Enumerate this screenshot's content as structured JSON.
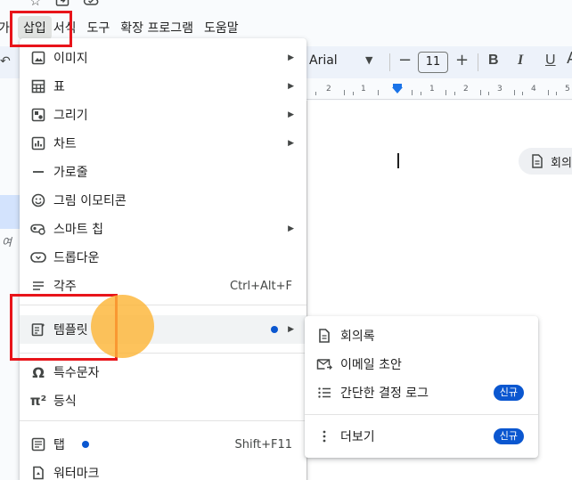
{
  "colors": {
    "accent": "#0b57d0",
    "highlight_box": "#e8141a",
    "pointer": "#fdb638",
    "menu_hover": "#f1f3f4"
  },
  "top_icons": [
    "star-icon",
    "move-to-folder-icon",
    "cloud-status-icon"
  ],
  "menubar": {
    "items": [
      {
        "label": "삽입",
        "active": true
      },
      {
        "label": "서식"
      },
      {
        "label": "도구"
      },
      {
        "label": "확장 프로그램"
      },
      {
        "label": "도움말"
      }
    ]
  },
  "toolbar": {
    "font_name": "Arial",
    "font_size": "11",
    "minus": "−",
    "plus": "+",
    "bold": "B",
    "italic": "I",
    "underline": "U"
  },
  "ruler": {
    "numbers": [
      "2",
      "1",
      "1",
      "2",
      "3",
      "4",
      "5",
      "6"
    ]
  },
  "sidebar": {
    "fragment_top": "가",
    "fragment_side": "여"
  },
  "insert_menu": {
    "items": [
      {
        "label": "이미지",
        "icon": "image-icon",
        "submenu": true
      },
      {
        "label": "표",
        "icon": "table-icon",
        "submenu": true
      },
      {
        "label": "그리기",
        "icon": "drawing-icon",
        "submenu": true
      },
      {
        "label": "차트",
        "icon": "chart-icon",
        "submenu": true
      },
      {
        "label": "가로줄",
        "icon": "horizontal-line-icon"
      },
      {
        "label": "그림 이모티콘",
        "icon": "emoji-icon"
      },
      {
        "label": "스마트 칩",
        "icon": "smart-chip-icon",
        "submenu": true
      },
      {
        "label": "드롭다운",
        "icon": "dropdown-icon"
      },
      {
        "label": "각주",
        "icon": "footnote-icon",
        "shortcut": "Ctrl+Alt+F"
      },
      {
        "label": "템플릿",
        "icon": "template-icon",
        "submenu": true,
        "dot": true
      },
      {
        "label": "특수문자",
        "icon": "omega-icon"
      },
      {
        "label": "등식",
        "icon": "equation-icon"
      },
      {
        "label": "탭",
        "icon": "tab-icon",
        "shortcut": "Shift+F11",
        "dot": true
      },
      {
        "label": "워터마크",
        "icon": "watermark-icon"
      }
    ]
  },
  "template_submenu": {
    "items": [
      {
        "label": "회의록",
        "icon": "document-icon"
      },
      {
        "label": "이메일 초안",
        "icon": "email-draft-icon"
      },
      {
        "label": "간단한 결정 로그",
        "icon": "checklist-icon",
        "badge": "신규"
      },
      {
        "label": "더보기",
        "icon": "more-vert-icon",
        "badge": "신규"
      }
    ]
  },
  "doc": {
    "chip_label": "회의"
  }
}
